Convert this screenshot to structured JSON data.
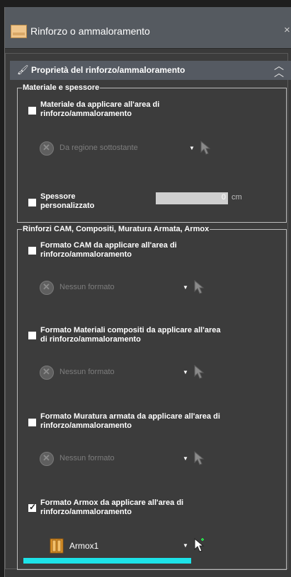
{
  "window": {
    "title": "Rinforzo o ammaloramento",
    "close_glyph": "×"
  },
  "section": {
    "title": "Proprietà del rinforzo/ammaloramento",
    "icon": "brush-icon",
    "collapse_glyph": "︽"
  },
  "group_material": {
    "legend": "Materiale e spessore",
    "material_checkbox_label_1": "Materiale da applicare all'area di",
    "material_checkbox_label_2": "rinforzo/ammaloramento",
    "material_checked": false,
    "material_combo_value": "Da regione sottostante",
    "thickness_label_1": "Spessore",
    "thickness_label_2": "personalizzato",
    "thickness_checked": false,
    "thickness_value": "0",
    "thickness_unit": "cm"
  },
  "group_reinforcements": {
    "legend": "Rinforzi CAM, Compositi, Muratura Armata, Armox",
    "cam": {
      "label_1": "Formato CAM da applicare all'area di",
      "label_2": "rinforzo/ammaloramento",
      "checked": false,
      "combo_value": "Nessun formato"
    },
    "composites": {
      "label_1": "Formato Materiali compositi da applicare all'area",
      "label_2": "di rinforzo/ammaloramento",
      "checked": false,
      "combo_value": "Nessun formato"
    },
    "masonry": {
      "label_1": "Formato Muratura armata da applicare all'area di",
      "label_2": "rinforzo/ammaloramento",
      "checked": false,
      "combo_value": "Nessun formato"
    },
    "armox": {
      "label_1": "Formato Armox da applicare all'area di",
      "label_2": "rinforzo/ammaloramento",
      "checked": true,
      "combo_value": "Armox1"
    }
  },
  "colors": {
    "highlight": "#1de3e8",
    "panel": "#3c3c3c",
    "titlebar": "#555a60"
  }
}
